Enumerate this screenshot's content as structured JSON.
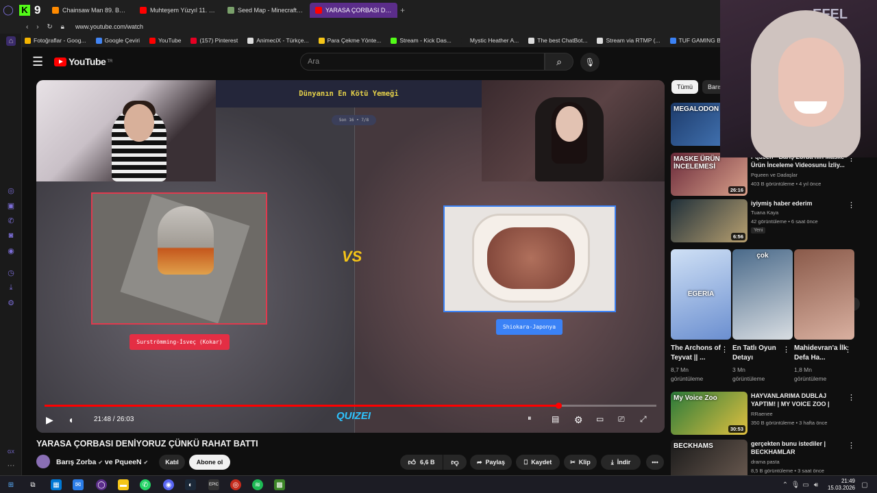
{
  "browser": {
    "tabs": [
      {
        "label": "Chainsaw Man 89. Bölüm",
        "color": "#ff8a00"
      },
      {
        "label": "Muhteşem Yüzyıl 11. Bölüm",
        "color": "#ff0000"
      },
      {
        "label": "Seed Map - Minecraft App",
        "color": "#7aa06b"
      },
      {
        "label": "YARASA ÇORBASI DENİYO",
        "color": "#ff0000"
      }
    ],
    "url": "www.youtube.com/watch",
    "bookmarks": [
      {
        "label": "Fotoğraflar - Goog...",
        "color": "#f4b400"
      },
      {
        "label": "Google Çeviri",
        "color": "#4285f4"
      },
      {
        "label": "YouTube",
        "color": "#ff0000"
      },
      {
        "label": "(157) Pinterest",
        "color": "#e60023"
      },
      {
        "label": "AnimeciX - Türkçe...",
        "color": "#dddddd"
      },
      {
        "label": "Para Çekme Yönte...",
        "color": "#f5c518"
      },
      {
        "label": "Stream - Kick Das...",
        "color": "#53fc18"
      },
      {
        "label": "Mystic Heather A...",
        "color": "#1f1f1f"
      },
      {
        "label": "The best ChatBot...",
        "color": "#dddddd"
      },
      {
        "label": "Stream via RTMP (...",
        "color": "#dddddd"
      },
      {
        "label": "TUF GAMING B66",
        "color": "#3b82f6"
      }
    ]
  },
  "youtube": {
    "logo_text": "YouTube",
    "region": "TR",
    "search_placeholder": "Ara"
  },
  "video": {
    "screen_title": "Dünyanın En Kötü Yemeği",
    "round_label": "Son 16 • 7/8",
    "left_label": "Surströmming-İsveç (Kokar)",
    "right_label": "Shiokara-Japonya",
    "vs": "VS",
    "brand": "QUIZEI",
    "time": "21:48 / 26:03",
    "progress": 0.84,
    "title": "YARASA ÇORBASI DENİYORUZ ÇÜNKÜ RAHAT BATTI",
    "channel": "Barış Zorba",
    "channel_extra": "ve PqueeN",
    "join": "Katıl",
    "subscribe": "Abone ol",
    "likes": "6,6 B",
    "share": "Paylaş",
    "save": "Kaydet",
    "clip": "Klip",
    "download": "İndir"
  },
  "chips": [
    "Tümü",
    "Barış"
  ],
  "recommendations": [
    {
      "title": "",
      "meta1": "",
      "meta2": "",
      "duration": "",
      "colors": [
        "#1d3b6b",
        "#4a7fc1"
      ],
      "thumb_text": "MEGALODON"
    },
    {
      "title": "Pqueen - Barış Zorba'nın Maske Ürün İnceleme Videosunu İzliy...",
      "meta1": "Pqueen ve Dadaşlar",
      "meta2": "403 B görüntüleme • 4 yıl önce",
      "duration": "26:16",
      "colors": [
        "#6a2a3a",
        "#d9a08a"
      ],
      "thumb_text": "MASKE ÜRÜN İNCELEMESİ"
    },
    {
      "title": "iyiymiş haber ederim",
      "meta1": "Tuana Kaya",
      "meta2": "42 görüntüleme • 6 saat önce",
      "duration": "6:56",
      "badge": "Yeni",
      "colors": [
        "#20303a",
        "#b8a070"
      ],
      "thumb_text": ""
    }
  ],
  "shorts": [
    {
      "title": "The Archons of Teyvat || ...",
      "views1": "8,7 Mn",
      "views2": "görüntüleme",
      "colors": [
        "#cfe0f5",
        "#6b8fd0"
      ],
      "overlay": "EGERIA"
    },
    {
      "title": "En Tatlı Oyun Detayı",
      "views1": "3 Mn",
      "views2": "görüntüleme",
      "colors": [
        "#4a6a8a",
        "#d8dde2"
      ],
      "overlay": "çok"
    },
    {
      "title": "Mahidevran'a İlk Defa Ha...",
      "views1": "1,8 Mn",
      "views2": "görüntüleme",
      "colors": [
        "#8a5a4a",
        "#d9b0a0"
      ],
      "overlay": ""
    }
  ],
  "recommendations2": [
    {
      "title": "HAYVANLARIMA DUBLAJ YAPTIM! | MY VOICE ZOO |",
      "meta1": "RRaenee",
      "meta2": "350 B görüntüleme • 3 hafta önce",
      "duration": "30:53",
      "colors": [
        "#2a7a3a",
        "#e0c040"
      ],
      "thumb_text": "My Voice Zoo"
    },
    {
      "title": "gerçekten bunu istediler | BECKHAMLAR",
      "meta1": "drama pasta",
      "meta2": "8,5 B görüntüleme • 3 saat önce",
      "duration": "",
      "colors": [
        "#1a1a1a",
        "#6a5a50"
      ],
      "thumb_text": "BECKHAMS"
    }
  ],
  "webcam_sign": "EFEL REA",
  "taskbar": {
    "time": "21:49",
    "date": "15.03.2026"
  }
}
